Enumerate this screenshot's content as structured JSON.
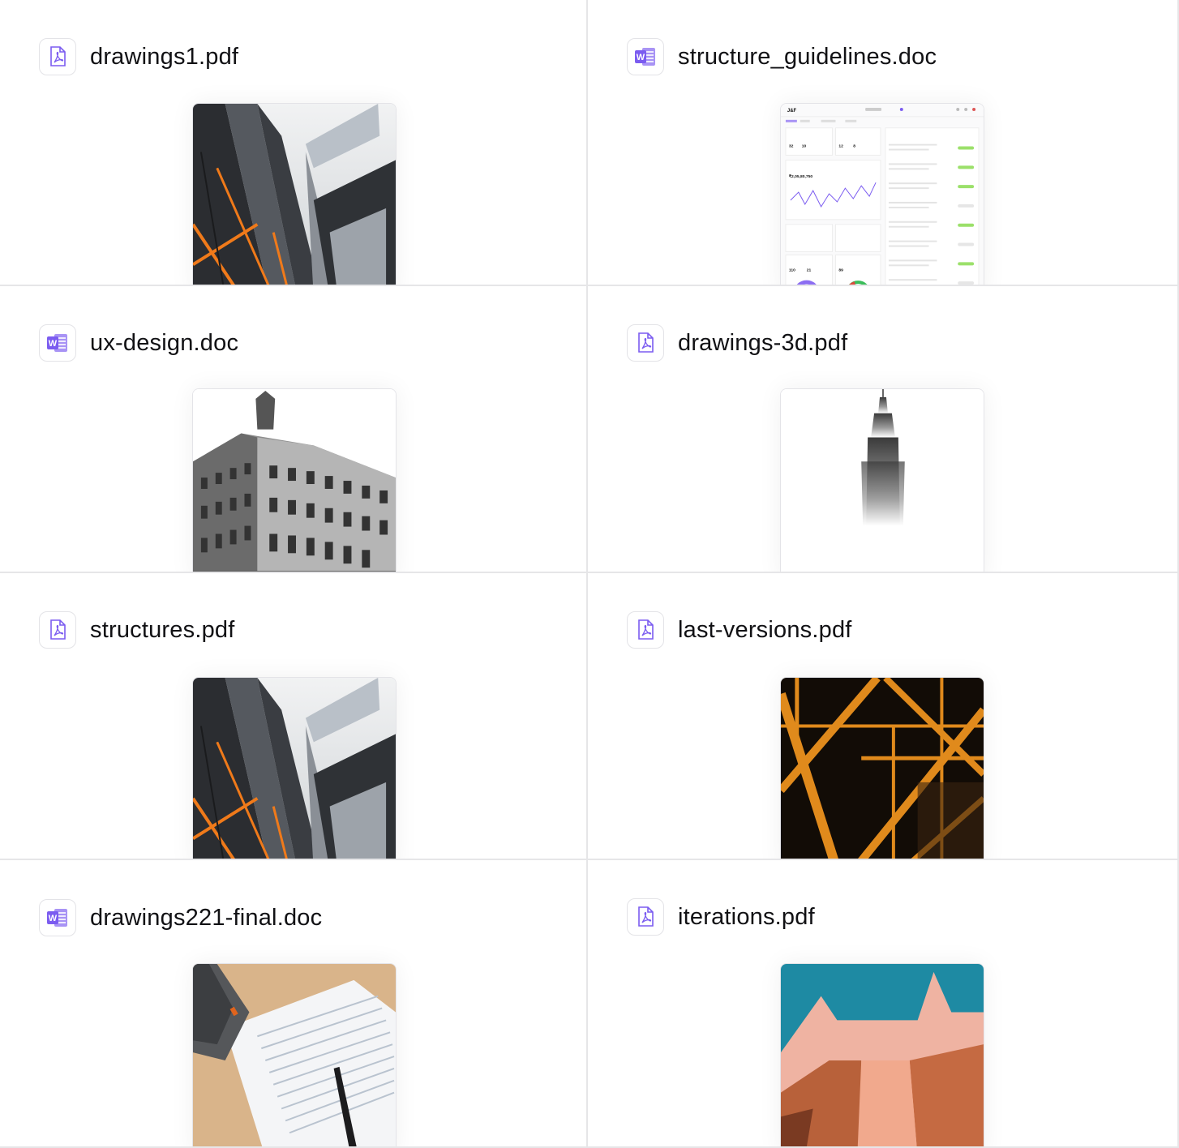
{
  "files": [
    {
      "name": "drawings1.pdf",
      "type": "pdf",
      "icon": "pdf-icon",
      "thumbnail": "skyscraper-photo"
    },
    {
      "name": "structure_guidelines.doc",
      "type": "doc",
      "icon": "word-doc-icon",
      "thumbnail": "dashboard-screenshot"
    },
    {
      "name": "ux-design.doc",
      "type": "doc",
      "icon": "word-doc-icon",
      "thumbnail": "classical-building-photo"
    },
    {
      "name": "drawings-3d.pdf",
      "type": "pdf",
      "icon": "pdf-icon",
      "thumbnail": "empire-state-building-photo"
    },
    {
      "name": "structures.pdf",
      "type": "pdf",
      "icon": "pdf-icon",
      "thumbnail": "skyscraper-photo"
    },
    {
      "name": "last-versions.pdf",
      "type": "pdf",
      "icon": "pdf-icon",
      "thumbnail": "steel-truss-photo"
    },
    {
      "name": "drawings221-final.doc",
      "type": "doc",
      "icon": "word-doc-icon",
      "thumbnail": "tax-form-photo"
    },
    {
      "name": "iterations.pdf",
      "type": "pdf",
      "icon": "pdf-icon",
      "thumbnail": "pink-architecture-photo"
    }
  ],
  "dashboard": {
    "logo": "J&F",
    "revenue": "₹2,05,80,750",
    "kpi1": "32",
    "kpi2": "10",
    "kpi3": "12",
    "kpi4": "8",
    "kpi5": "110",
    "kpi6": "21",
    "kpi7": "89"
  },
  "colors": {
    "accent": "#7b5cf0",
    "border": "#e6e6e8",
    "text": "#111114"
  }
}
